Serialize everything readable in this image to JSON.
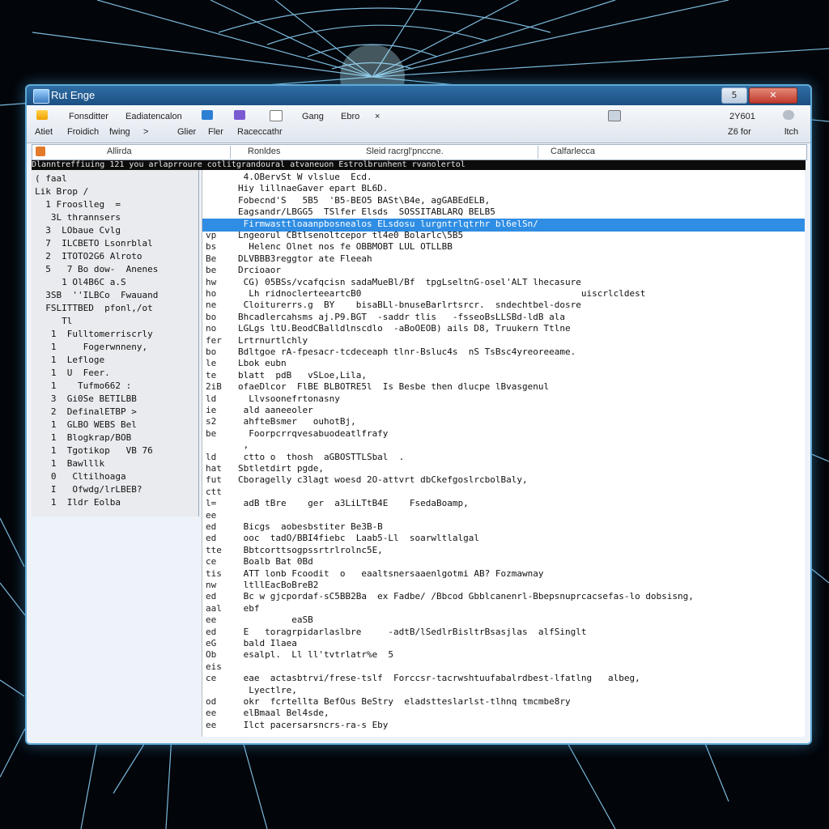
{
  "window": {
    "title": "Rut Enge",
    "controls": {
      "minimize": "5",
      "close": ""
    }
  },
  "ribbon": {
    "row1": [
      "Fonsditter",
      "Eadiatencalon",
      "Gang",
      "Ebro",
      "×"
    ],
    "row2": [
      "Atiet",
      "Froidich",
      "fwing",
      ">",
      "Glier",
      "Fler",
      "Raceccathr"
    ],
    "right": {
      "code": "2Y601",
      "sub_a": "Z6 for",
      "sub_b": "ltch"
    }
  },
  "addressbar": {
    "left_label": "Allirda",
    "mid_label": "Ronldes",
    "path": "Sleid racrgl'pnccne.",
    "right_label": "Calfarlecca"
  },
  "statusstrip": {
    "text": "Dlanntreffiuing    121 you  arlaprroure cotlitgrandoural atvaneuon Estrolbrunhent rvanolertol"
  },
  "left_panel": {
    "rows": [
      "( faal",
      "Lik Brop /",
      "  1 Frooslleg  =",
      "   3L thrannsers",
      "  3  LObaue Cvlg",
      "  7  ILCBETO Lsonrblal",
      "  2  ITOTO2G6 Alroto",
      "  5   7 Bo dow-  Anenes",
      "     1 Ol4B6C a.S",
      "  3SB  ''ILBCo  Fwauand",
      "  FSLITTBED  pfonl,/ot",
      "     Tl",
      "   1  Fulltomerriscrly",
      "   1     Fogerwnneny,",
      "   1  Lefloge",
      "   1  U  Feer.",
      "   1    Tufmo662 :",
      "   3  Gi0Se BETILBB",
      "   2  DefinalETBP >",
      "   1  GLBO WEBS Bel",
      "   1  Blogkrap/BOB",
      "   1  Tgotikop   VB 76",
      "   1  Bawlllk",
      "   0   Cltilhoaga",
      "   I   Ofwdg/lrLBEB?",
      "   1  Ildr Eolba"
    ]
  },
  "code": {
    "highlight_index": 4,
    "rows": [
      {
        "num": "",
        "text": " 4.OBervSt W vlslue  Ecd."
      },
      {
        "num": "",
        "text": "Hiy lillnaeGaver epart BL6D."
      },
      {
        "num": "",
        "text": "Fobecnd'S   5B5  'B5-BEO5 BASt\\B4e, agGABEdELB,"
      },
      {
        "num": "",
        "text": "Eagsandr/LBGG5  TSlfer Elsds  SOSSITABLARQ BELB5"
      },
      {
        "num": "",
        "text": " Firmwasttloaanpbosnealos ELsdosu lurgntrlqtrhr bl6elSn/"
      },
      {
        "num": "vp",
        "text": "Lngeorul CBtlsenoltcepor tl4e0 Bolarlc\\5B5"
      },
      {
        "num": "bs",
        "text": "  Helenc Olnet nos fe OBBMOBT LUL OTLLBB"
      },
      {
        "num": "Be",
        "text": "DLVBBB3reggtor ate Fleeah"
      },
      {
        "num": "be",
        "text": "Drcioaor"
      },
      {
        "num": "hw",
        "text": " CG) 05BSs/vcafqcisn sadaMueBl/Bf  tpgLseltnG-osel'ALT lhecasure"
      },
      {
        "num": "ho",
        "text": "  Lh ridnoclerteeartcB0                                         uiscrlcldest"
      },
      {
        "num": "ne",
        "text": " Cloiturerrs.g  BY    bisaBLl-bnuseBarlrtsrcr.  sndechtbel-dosre"
      },
      {
        "num": "bo",
        "text": "Bhcadlercahsms aj.P9.BGT  -saddr tlis   -fsseoBsLLSBd-ldB ala"
      },
      {
        "num": "no",
        "text": "LGLgs ltU.BeodCBalldlnscdlo  -aBoOEOB) ails D8, Truukern Ttlne"
      },
      {
        "num": "fer",
        "text": "Lrtrnurtlchly"
      },
      {
        "num": "bo",
        "text": "Bdltgoe rA-fpesacr-tcdeceaph tlnr-Bsluc4s  nS TsBsc4yreoreeame."
      },
      {
        "num": "le",
        "text": "Lbok eubn"
      },
      {
        "num": "te",
        "text": "blatt  pdB   vSLoe,Lila,"
      },
      {
        "num": "2iB",
        "text": "ofaeDlcor  FlBE BLBOTRE5l  Is Besbe then dlucpe lBvasgenul"
      },
      {
        "num": "ld",
        "text": "  Llvsoonefrtonasny"
      },
      {
        "num": "ie",
        "text": " ald aaneeoler"
      },
      {
        "num": "s2",
        "text": " ahfteBsmer   ouhotBj,"
      },
      {
        "num": "be",
        "text": "  Foorpcrrqvesabuodeatlfrafy"
      },
      {
        "num": "",
        "text": " ,"
      },
      {
        "num": "ld",
        "text": " ctto o  thosh  aGBOSTTLSbal  ."
      },
      {
        "num": "hat",
        "text": "Sbtletdirt pgde,"
      },
      {
        "num": "fut",
        "text": "Cboragelly c3lagt woesd 2O-attvrt dbCkefgoslrcbolBaly,"
      },
      {
        "num": "ctt",
        "text": ""
      },
      {
        "num": "l=",
        "text": " adB tBre    ger  a3LiLTtB4E    FsedaBoamp,"
      },
      {
        "num": "ee",
        "text": ""
      },
      {
        "num": "ed",
        "text": " Bicgs  aobesbstiter Be3B-B"
      },
      {
        "num": "ed",
        "text": " ooc  tadO/BBI4fiebc  Laab5-Ll  soarwltlalgal"
      },
      {
        "num": "tte",
        "text": " Bbtcorttsogpssrtrlrolnc5E,"
      },
      {
        "num": "ce",
        "text": " Boalb Bat 0Bd"
      },
      {
        "num": "tis",
        "text": " ATT lonb Fcoodit  o   eaaltsnersaaenlgotmi AB? Fozmawnay"
      },
      {
        "num": "nw",
        "text": " ltllEacBoBreB2"
      },
      {
        "num": "ed",
        "text": " Bc w gjcpordaf-sC5BB2Ba  ex Fadbe/ /Bbcod Gbblcanenrl-Bbepsnuprcacsefas-lo dobsisng,"
      },
      {
        "num": "aal",
        "text": " ebf"
      },
      {
        "num": "ee",
        "text": "          eaSB"
      },
      {
        "num": "ed",
        "text": " E   toragrpidarlaslbre     -adtB/lSedlrBisltrBsasjlas  alfSinglt"
      },
      {
        "num": "eG",
        "text": " bald Ilaea"
      },
      {
        "num": "Ob",
        "text": " esalpl.  Ll ll'tvtrlatr%e  5"
      },
      {
        "num": "eis",
        "text": ""
      },
      {
        "num": "ce",
        "text": " eae  actasbtrvi/frese-tslf  Forccsr-tacrwshtuufabalrdbest-lfatlng   albeg,"
      },
      {
        "num": "",
        "text": "  Lyectlre,"
      },
      {
        "num": "od",
        "text": " okr  fcrtellta BefOus BeStry  eladstteslarlst-tlhnq tmcmbe8ry"
      },
      {
        "num": "ee",
        "text": " elBmaal Bel4sde,"
      },
      {
        "num": "ee",
        "text": " Ilct pacersarsncrs-ra-s Eby"
      }
    ]
  }
}
